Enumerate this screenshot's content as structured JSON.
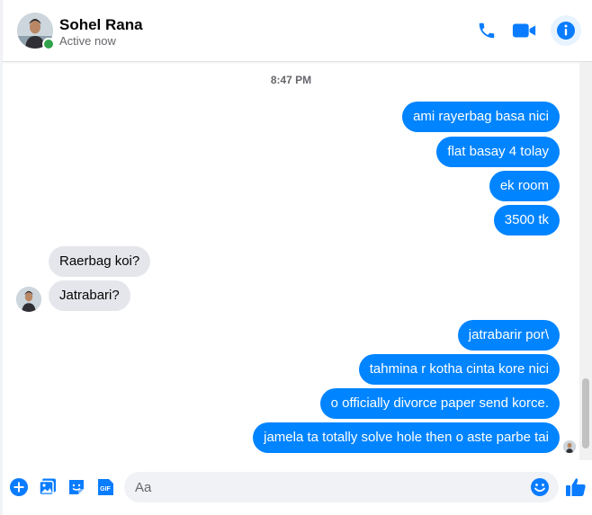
{
  "header": {
    "name": "Sohel Rana",
    "status": "Active now"
  },
  "chat": {
    "timestamp": "8:47 PM",
    "messages": [
      {
        "dir": "out",
        "text": "ami rayerbag basa nici"
      },
      {
        "dir": "out",
        "text": "flat basay  4 tolay"
      },
      {
        "dir": "out",
        "text": "ek room"
      },
      {
        "dir": "out",
        "text": "3500 tk"
      },
      {
        "dir": "in",
        "text": "Raerbag koi?"
      },
      {
        "dir": "in",
        "text": "Jatrabari?"
      },
      {
        "dir": "out",
        "text": "jatrabarir por\\"
      },
      {
        "dir": "out",
        "text": "tahmina r kotha cinta kore nici"
      },
      {
        "dir": "out",
        "text": "o officially divorce paper send korce."
      },
      {
        "dir": "out",
        "text": "jamela ta totally solve hole then o aste parbe tai"
      }
    ]
  },
  "composer": {
    "placeholder": "Aa",
    "gif_label": "GIF"
  },
  "colors": {
    "accent": "#0084ff",
    "icon": "#0a7cff",
    "online": "#31a24c",
    "incoming": "#e4e6eb"
  }
}
